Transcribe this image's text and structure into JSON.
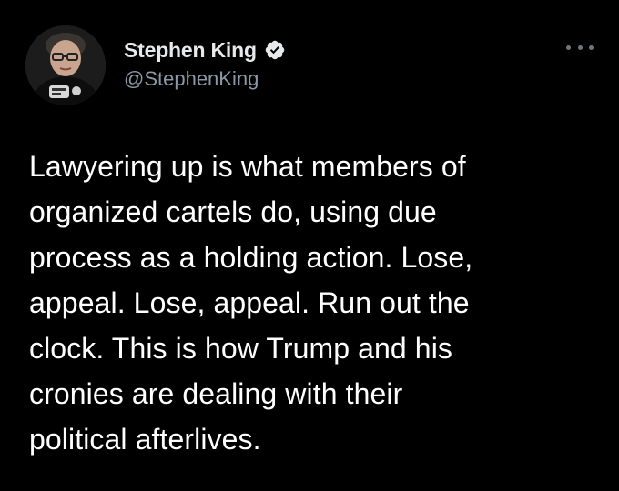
{
  "author": {
    "display_name": "Stephen King",
    "handle": "@StephenKing",
    "verified": true,
    "verified_color": "#e7e9ea"
  },
  "tweet": {
    "text": "Lawyering up is what members of\norganized cartels do, using due\nprocess as a holding action. Lose,\nappeal. Lose, appeal. Run out the\nclock. This is how Trump and his\ncronies are dealing with their\npolitical afterlives."
  },
  "menu": {
    "icon": "more-horizontal-icon"
  },
  "colors": {
    "background": "#000000",
    "text": "#ffffff",
    "secondary": "#8b98a5"
  }
}
